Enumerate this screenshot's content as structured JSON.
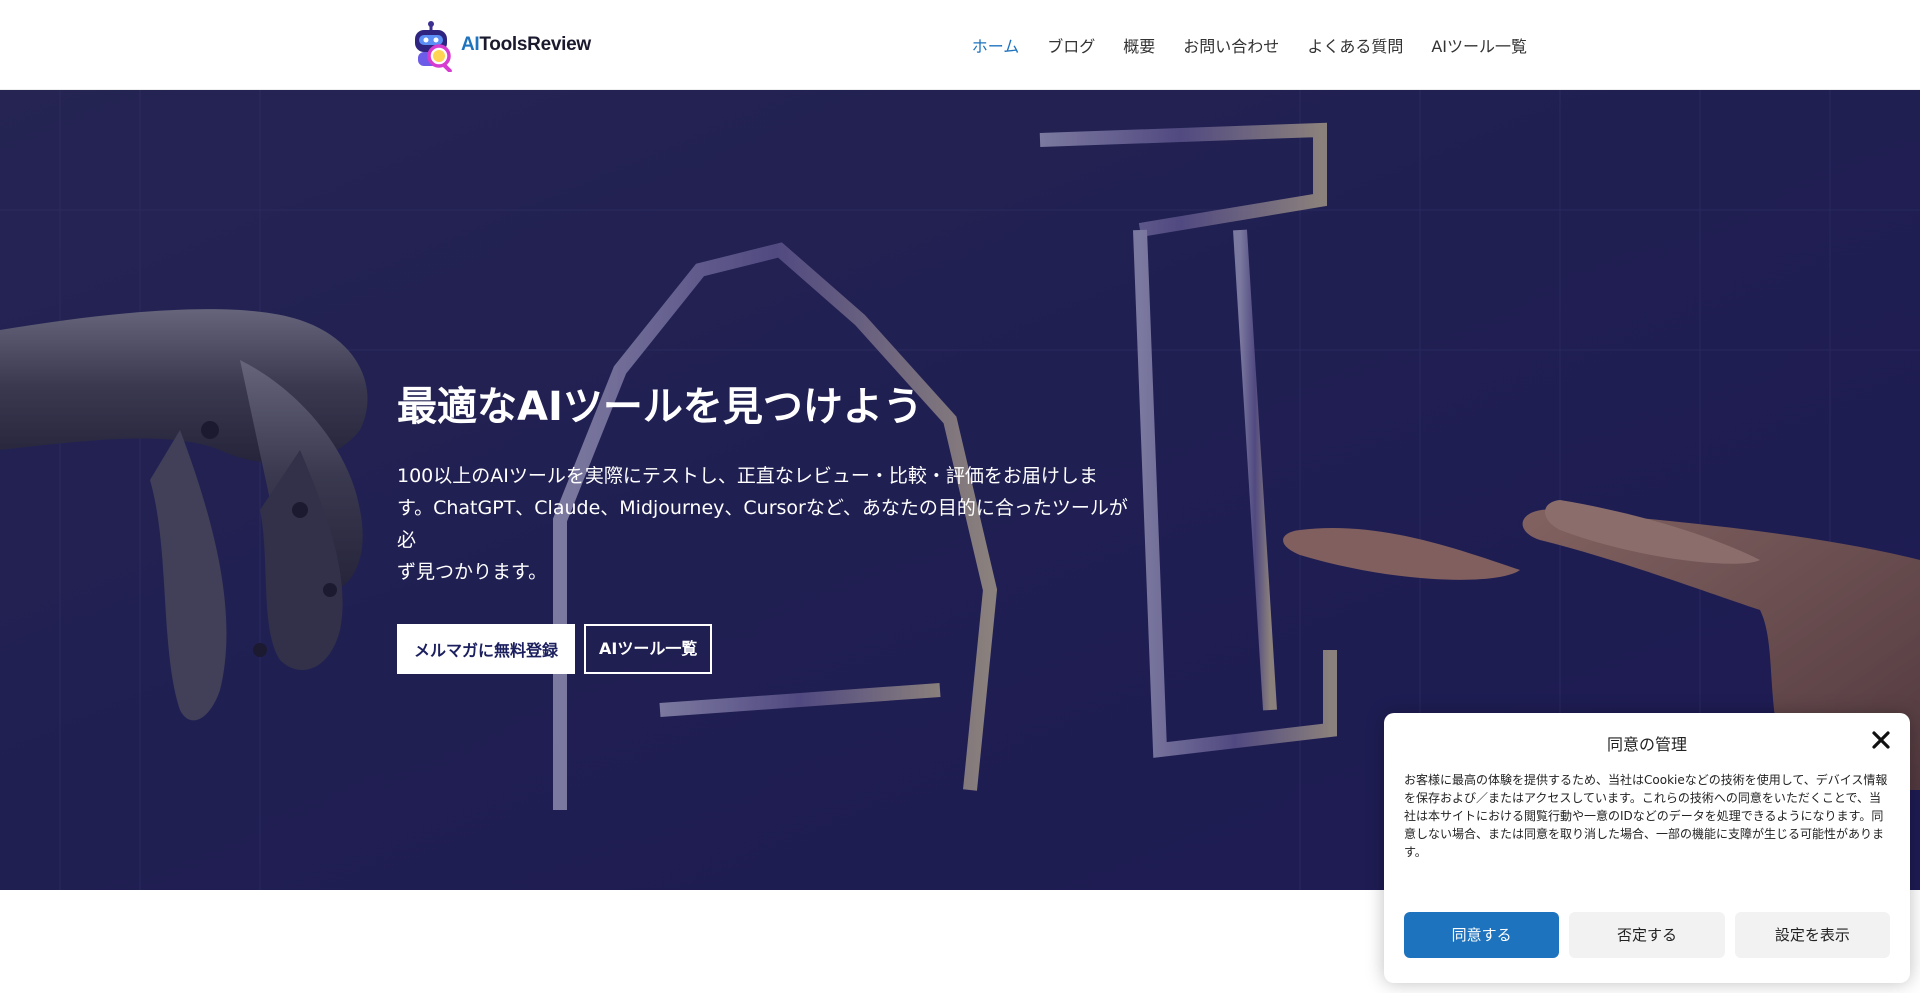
{
  "header": {
    "logo": {
      "prefix": "AI",
      "name": "ToolsReview"
    },
    "nav": [
      {
        "label": "ホーム",
        "active": true
      },
      {
        "label": "ブログ",
        "active": false
      },
      {
        "label": "概要",
        "active": false
      },
      {
        "label": "お問い合わせ",
        "active": false
      },
      {
        "label": "よくある質問",
        "active": false
      },
      {
        "label": "AIツール一覧",
        "active": false
      }
    ]
  },
  "hero": {
    "title": "最適なAIツールを見つけよう",
    "description_lines": [
      "100以上のAIツールを実際にテストし、正直なレビュー・比較・評価をお届けしま",
      "す。ChatGPT、Claude、Midjourney、Cursorなど、あなたの目的に合ったツールが必",
      "ず見つかります。"
    ],
    "buttons": {
      "primary": "メルマガに無料登録",
      "secondary": "AIツール一覧"
    }
  },
  "consent": {
    "title": "同意の管理",
    "body_lines": [
      "お客様に最高の体験を提供するため、当社はCookieなどの技術を使用して、デバイス情報",
      "を保存および／またはアクセスしています。これらの技術への同意をいただくことで、当",
      "社は本サイトにおける閲覧行動や一意のIDなどのデータを処理できるようになります。同",
      "意しない場合、または同意を取り消した場合、一部の機能に支障が生じる可能性がありま",
      "す。"
    ],
    "accept": "同意する",
    "deny": "否定する",
    "preferences": "設定を表示"
  },
  "colors": {
    "accent": "#1e73be",
    "hero_bg": "#232250",
    "button_text": "#1b1f5e"
  }
}
